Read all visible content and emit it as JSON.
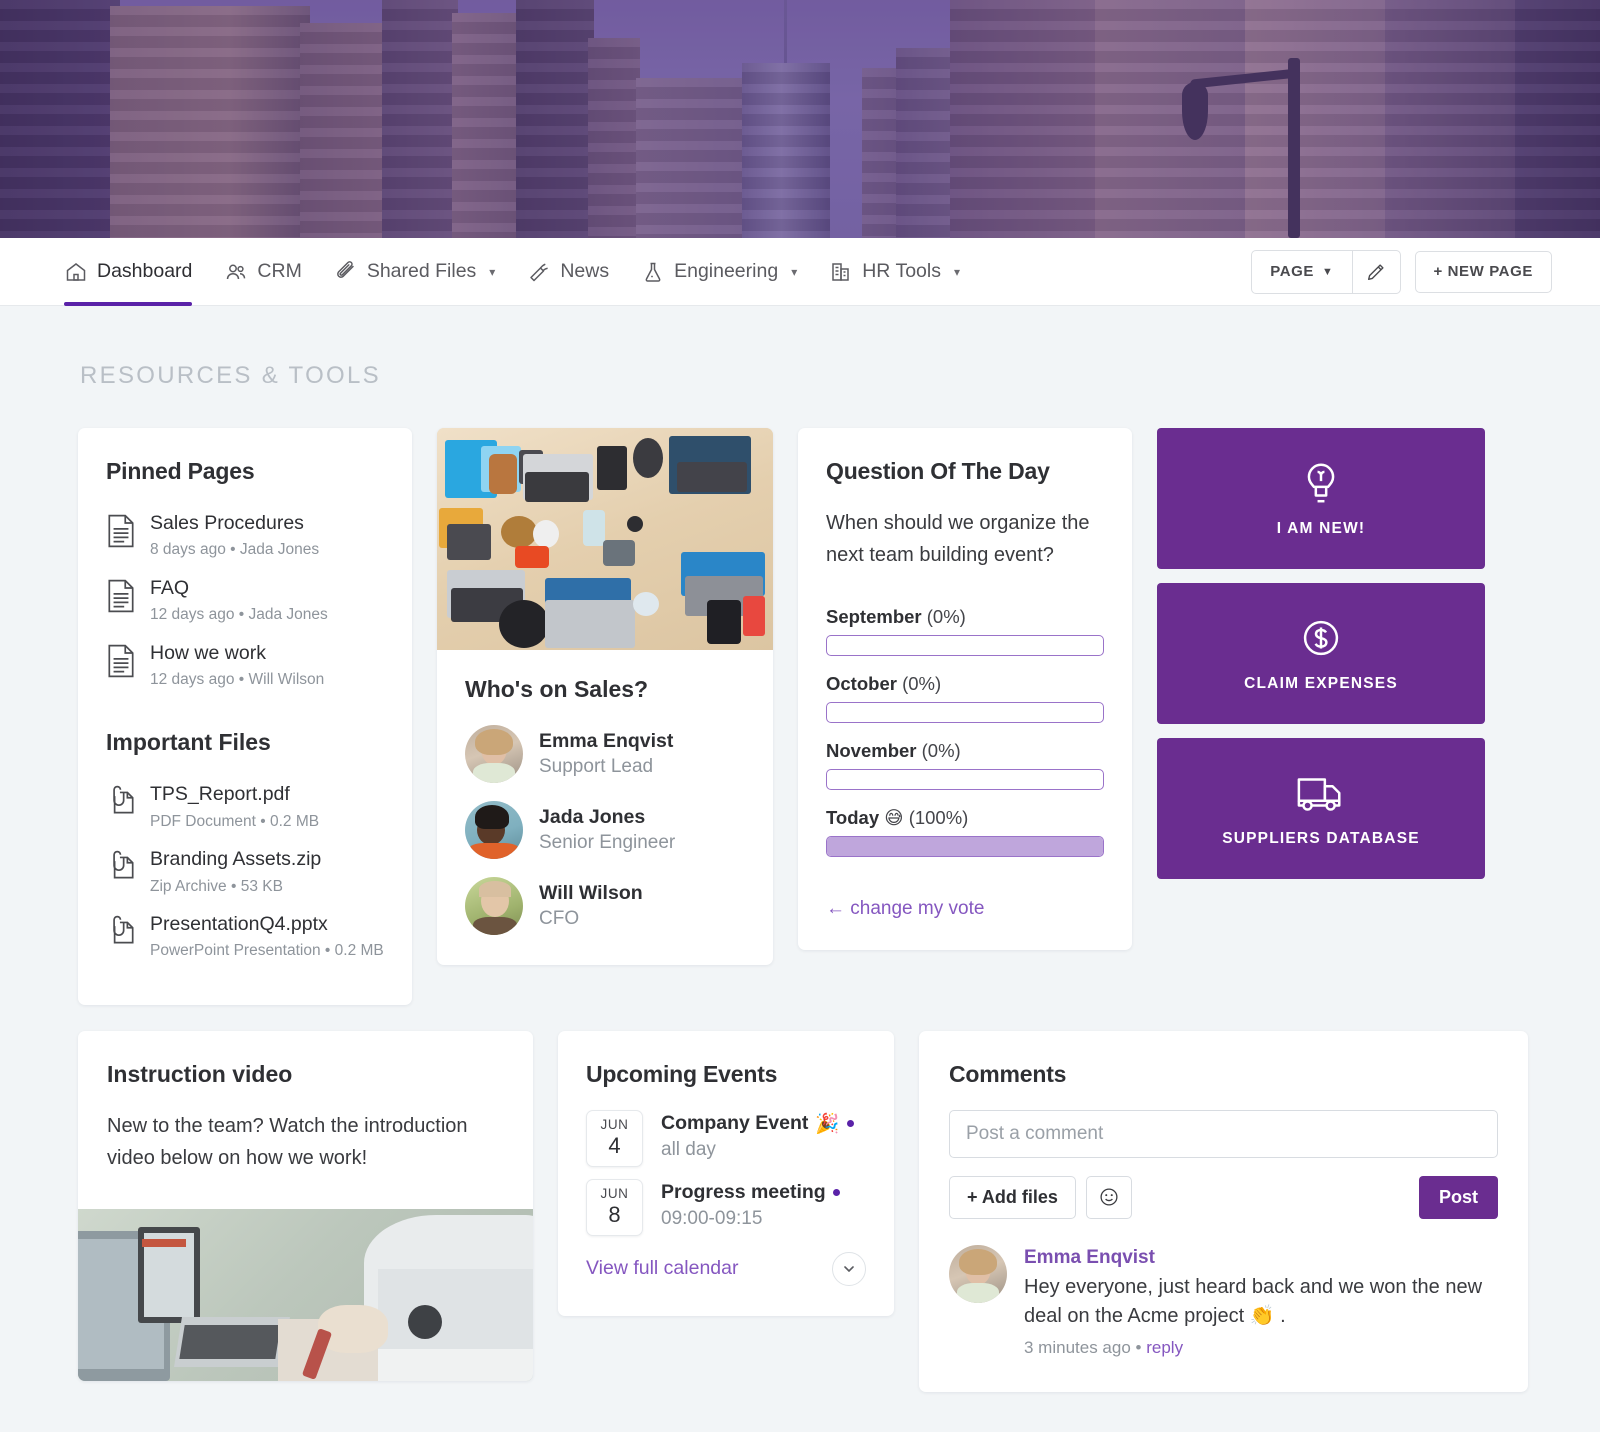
{
  "nav": {
    "tabs": [
      {
        "label": "Dashboard",
        "icon": "home-icon",
        "active": true,
        "caret": false
      },
      {
        "label": "CRM",
        "icon": "people-icon",
        "active": false,
        "caret": false
      },
      {
        "label": "Shared Files",
        "icon": "paperclip-icon",
        "active": false,
        "caret": true
      },
      {
        "label": "News",
        "icon": "megaphone-icon",
        "active": false,
        "caret": false
      },
      {
        "label": "Engineering",
        "icon": "flask-icon",
        "active": false,
        "caret": true
      },
      {
        "label": "HR Tools",
        "icon": "building-icon",
        "active": false,
        "caret": true
      }
    ],
    "page_button": "PAGE",
    "page_caret": "▼",
    "edit_icon": "pencil-icon",
    "new_page_button": "+ NEW PAGE"
  },
  "section": {
    "title": "RESOURCES & TOOLS"
  },
  "pinned": {
    "heading": "Pinned Pages",
    "pages": [
      {
        "name": "Sales Procedures",
        "meta": "8 days ago • Jada Jones"
      },
      {
        "name": "FAQ",
        "meta": "12 days ago • Jada Jones"
      },
      {
        "name": "How we work",
        "meta": "12 days ago • Will Wilson"
      }
    ],
    "files_heading": "Important Files",
    "files": [
      {
        "name": "TPS_Report.pdf",
        "meta": "PDF Document • 0.2 MB"
      },
      {
        "name": "Branding Assets.zip",
        "meta": "Zip Archive • 53 KB"
      },
      {
        "name": "PresentationQ4.pptx",
        "meta": "PowerPoint Presentation • 0.2 MB"
      }
    ]
  },
  "team": {
    "heading": "Who's on Sales?",
    "members": [
      {
        "name": "Emma Enqvist",
        "role": "Support Lead"
      },
      {
        "name": "Jada Jones",
        "role": "Senior Engineer"
      },
      {
        "name": "Will Wilson",
        "role": "CFO"
      }
    ]
  },
  "poll": {
    "heading": "Question Of The Day",
    "question": "When should we organize the next team building event?",
    "options": [
      {
        "label": "September",
        "emoji": "",
        "percent_text": "(0%)",
        "percent": 0
      },
      {
        "label": "October",
        "emoji": "",
        "percent_text": "(0%)",
        "percent": 0
      },
      {
        "label": "November",
        "emoji": "",
        "percent_text": "(0%)",
        "percent": 0
      },
      {
        "label": "Today",
        "emoji": "😅",
        "percent_text": "(100%)",
        "percent": 100
      }
    ],
    "change_vote": "← change my vote"
  },
  "tiles": [
    {
      "label": "I AM NEW!",
      "icon": "lightbulb-icon"
    },
    {
      "label": "CLAIM EXPENSES",
      "icon": "dollar-circle-icon"
    },
    {
      "label": "SUPPLIERS DATABASE",
      "icon": "truck-icon"
    }
  ],
  "video": {
    "heading": "Instruction video",
    "body": "New to the team? Watch the introduction video below on how we work!"
  },
  "events": {
    "heading": "Upcoming Events",
    "items": [
      {
        "month": "JUN",
        "day": "4",
        "title": "Company Event",
        "emoji": "🎉",
        "time": "all day"
      },
      {
        "month": "JUN",
        "day": "8",
        "title": "Progress meeting",
        "emoji": "",
        "time": "09:00-09:15"
      }
    ],
    "link": "View full calendar",
    "more_icon": "chevron-down-icon"
  },
  "comments": {
    "heading": "Comments",
    "placeholder": "Post a comment",
    "value": "",
    "add_files": "+ Add files",
    "emoji_icon": "smiley-icon",
    "post": "Post",
    "list": [
      {
        "author": "Emma Enqvist",
        "text": "Hey everyone, just heard back and we won the new deal on the Acme project 👏 .",
        "time": "3 minutes ago",
        "reply": "reply",
        "separator": "•"
      }
    ]
  },
  "colors": {
    "brand_purple": "#6a2d90",
    "active_underline": "#5a22a8",
    "link_purple": "#8557c0",
    "poll_fill": "#bfa6dc",
    "poll_border": "#9a73c9",
    "page_bg": "#f2f5f7"
  }
}
